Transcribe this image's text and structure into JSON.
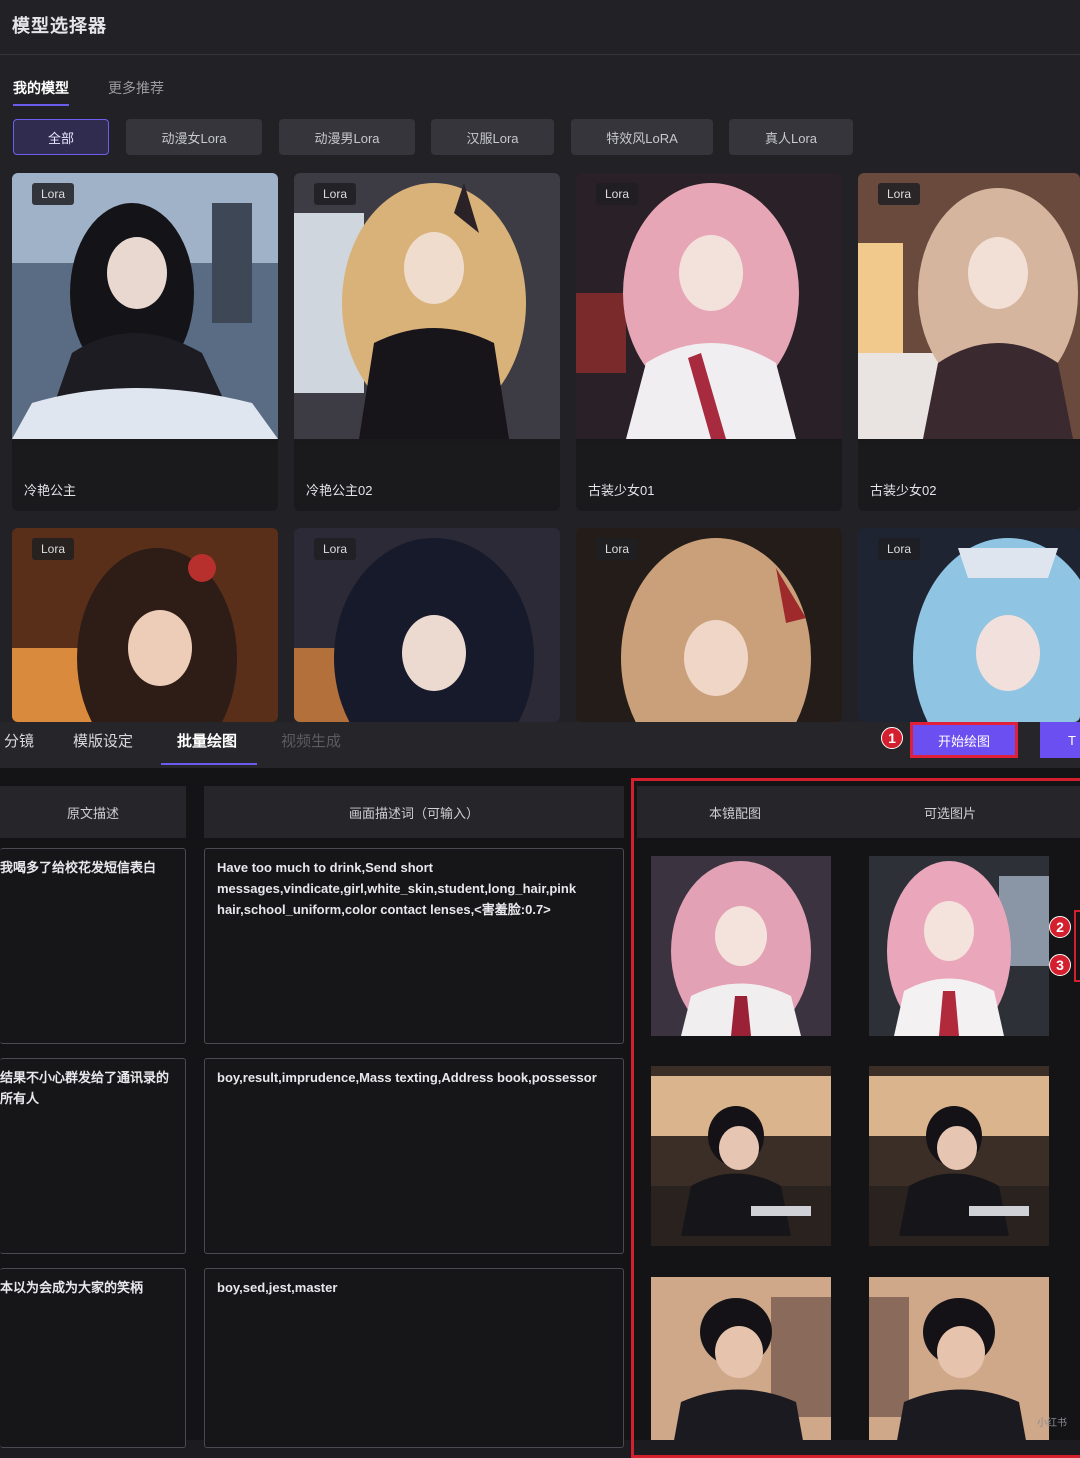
{
  "model_selector": {
    "title": "模型选择器",
    "tabs": [
      {
        "label": "我的模型",
        "active": true
      },
      {
        "label": "更多推荐",
        "active": false
      }
    ],
    "filters": [
      {
        "label": "全部",
        "active": true
      },
      {
        "label": "动漫女Lora",
        "active": false
      },
      {
        "label": "动漫男Lora",
        "active": false
      },
      {
        "label": "汉服Lora",
        "active": false
      },
      {
        "label": "特效风LoRA",
        "active": false
      },
      {
        "label": "真人Lora",
        "active": false
      }
    ],
    "cards": [
      {
        "badge": "Lora",
        "name": "冷艳公主"
      },
      {
        "badge": "Lora",
        "name": "冷艳公主02"
      },
      {
        "badge": "Lora",
        "name": "古装少女01"
      },
      {
        "badge": "Lora",
        "name": "古装少女02"
      },
      {
        "badge": "Lora",
        "name": ""
      },
      {
        "badge": "Lora",
        "name": ""
      },
      {
        "badge": "Lora",
        "name": ""
      },
      {
        "badge": "Lora",
        "name": ""
      }
    ]
  },
  "storyboard": {
    "tabs": [
      {
        "label": "分镜",
        "active": false,
        "muted": false
      },
      {
        "label": "模版设定",
        "active": false,
        "muted": false
      },
      {
        "label": "批量绘图",
        "active": true,
        "muted": false
      },
      {
        "label": "视频生成",
        "active": false,
        "muted": true
      }
    ],
    "start_button": "开始绘图",
    "extra_button": "T",
    "markers": [
      "1",
      "2",
      "3"
    ],
    "columns": {
      "original": "原文描述",
      "prompt": "画面描述词（可输入）",
      "current": "本镜配图",
      "optional": "可选图片"
    },
    "rows": [
      {
        "original": "我喝多了给校花发短信表白",
        "prompt": "Have too much to drink,Send short messages,vindicate,girl,white_skin,student,long_hair,pink hair,school_uniform,color contact lenses,<害羞脸:0.7>"
      },
      {
        "original": "结果不小心群发给了通讯录的所有人",
        "prompt": "boy,result,imprudence,Mass texting,Address book,possessor"
      },
      {
        "original": "本以为会成为大家的笑柄",
        "prompt": "boy,sed,jest,master"
      }
    ],
    "watermark": "小红书"
  },
  "colors": {
    "accent": "#6b4ff0",
    "highlight_red": "#d4202e",
    "background": "#1c1c20"
  }
}
